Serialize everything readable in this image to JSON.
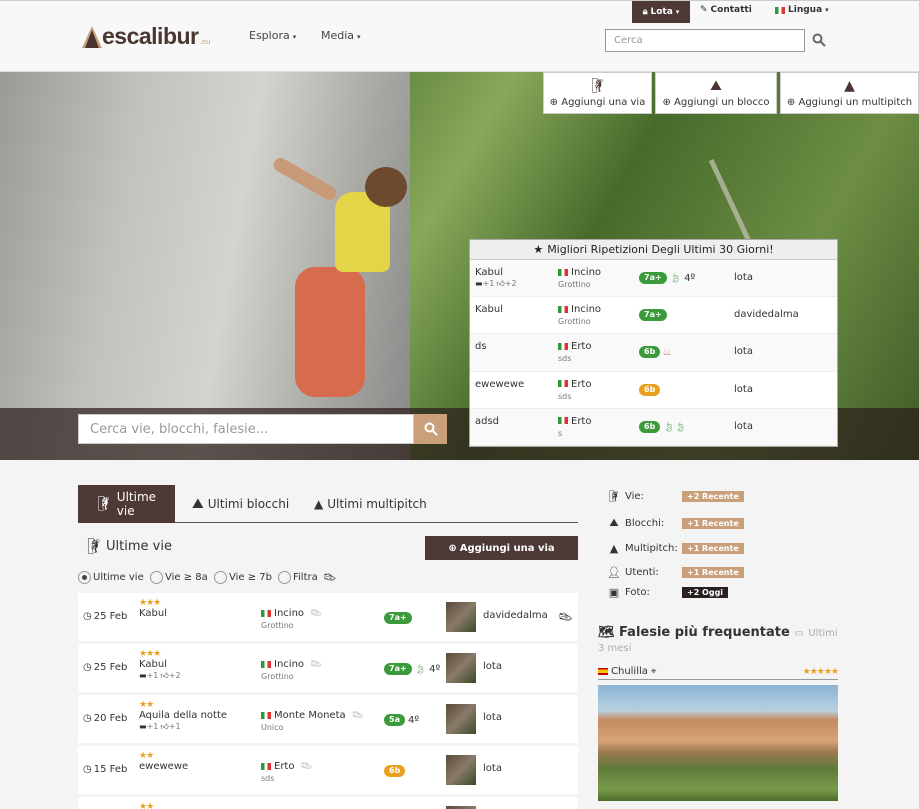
{
  "brand": {
    "name": "escalibur",
    "suffix": ".eu"
  },
  "nav": {
    "items": [
      {
        "label": "Esplora"
      },
      {
        "label": "Media"
      }
    ],
    "user": "Lota",
    "contacts": "Contatti",
    "language": "Lingua",
    "search_placeholder": "Cerca"
  },
  "hero": {
    "search_placeholder": "Cerca vie, blocchi, falesie...",
    "add_buttons": [
      {
        "label": "Aggiungi una via",
        "icon": "climber-icon"
      },
      {
        "label": "Aggiungi un blocco",
        "icon": "boulder-icon"
      },
      {
        "label": "Aggiungi un multipitch",
        "icon": "mountain-icon"
      }
    ]
  },
  "best": {
    "title": "Migliori Ripetizioni Degli Ultimi 30 Giorni!",
    "rows": [
      {
        "route": "Kabul",
        "comments": "+1",
        "likes": "+2",
        "crag": "Incino",
        "sector": "Grottino",
        "grade": "7a+",
        "grade_color": "green",
        "extra": "4º",
        "style": "leaf1",
        "user": "lota"
      },
      {
        "route": "Kabul",
        "comments": "",
        "likes": "",
        "crag": "Incino",
        "sector": "Grottino",
        "grade": "7a+",
        "grade_color": "green",
        "extra": "",
        "style": "",
        "user": "davidedalma"
      },
      {
        "route": "ds",
        "comments": "",
        "likes": "",
        "crag": "Erto",
        "sector": "sds",
        "grade": "6b",
        "grade_color": "green",
        "extra": "",
        "style": "drops",
        "user": "lota"
      },
      {
        "route": "ewewewe",
        "comments": "",
        "likes": "",
        "crag": "Erto",
        "sector": "sds",
        "grade": "6b",
        "grade_color": "orange",
        "extra": "",
        "style": "",
        "user": "lota"
      },
      {
        "route": "adsd",
        "comments": "",
        "likes": "",
        "crag": "Erto",
        "sector": "s",
        "grade": "6b",
        "grade_color": "green",
        "extra": "",
        "style": "leaf2",
        "user": "lota"
      }
    ]
  },
  "tabs": [
    {
      "label": "Ultime vie",
      "icon": "climber-icon"
    },
    {
      "label": "Ultimi blocchi",
      "icon": "boulder-icon"
    },
    {
      "label": "Ultimi multipitch",
      "icon": "mountain-icon"
    }
  ],
  "section": {
    "title": "Ultime vie",
    "add_label": "Aggiungi una via"
  },
  "filters": [
    {
      "label": "Ultime vie",
      "checked": true
    },
    {
      "label": "Vie ≥ 8a",
      "checked": false
    },
    {
      "label": "Vie ≥ 7b",
      "checked": false
    },
    {
      "label": "Filtra",
      "checked": false
    }
  ],
  "recent": [
    {
      "date": "25 Feb",
      "stars": "★★★",
      "route": "Kabul",
      "comments": "",
      "likes": "",
      "crag": "Incino",
      "sector": "Grottino",
      "grade": "7a+",
      "grade_color": "green",
      "extra": "",
      "leaf": false,
      "user": "davidedalma"
    },
    {
      "date": "25 Feb",
      "stars": "★★★",
      "route": "Kabul",
      "comments": "+1",
      "likes": "+2",
      "crag": "Incino",
      "sector": "Grottino",
      "grade": "7a+",
      "grade_color": "green",
      "extra": "4º",
      "leaf": true,
      "user": "lota"
    },
    {
      "date": "20 Feb",
      "stars": "★★",
      "route": "Aquila della notte",
      "comments": "+1",
      "likes": "+1",
      "crag": "Monte Moneta",
      "sector": "Unico",
      "grade": "5a",
      "grade_color": "green",
      "extra": "4º",
      "leaf": false,
      "user": "lota"
    },
    {
      "date": "15 Feb",
      "stars": "★★",
      "route": "ewewewe",
      "comments": "",
      "likes": "",
      "crag": "Erto",
      "sector": "sds",
      "grade": "6b",
      "grade_color": "orange",
      "extra": "",
      "leaf": false,
      "user": "lota"
    },
    {
      "date": "",
      "stars": "★★",
      "route": "",
      "comments": "",
      "likes": "",
      "crag": "",
      "sector": "",
      "grade": "",
      "grade_color": "green",
      "extra": "",
      "leaf": false,
      "user": ""
    }
  ],
  "stats": [
    {
      "label": "Vie:",
      "badge": "+2 Recente",
      "icon": "climber-icon",
      "dark": false
    },
    {
      "label": "Blocchi:",
      "badge": "+1 Recente",
      "icon": "boulder-icon",
      "dark": false
    },
    {
      "label": "Multipitch:",
      "badge": "+1 Recente",
      "icon": "mountain-icon",
      "dark": false
    },
    {
      "label": "Utenti:",
      "badge": "+1 Recente",
      "icon": "user-icon",
      "dark": false
    },
    {
      "label": "Foto:",
      "badge": "+2 Oggi",
      "icon": "photo-icon",
      "dark": true
    }
  ],
  "frequent": {
    "title": "Falesie più frequentate",
    "period": "Ultimi 3 mesi",
    "crag": "Chulilla",
    "stars": "★★★★★"
  },
  "colors": {
    "brand": "#4d3a37",
    "accent": "#c9a07a",
    "grade_green": "#3b9a3b",
    "grade_orange": "#e9a020"
  }
}
